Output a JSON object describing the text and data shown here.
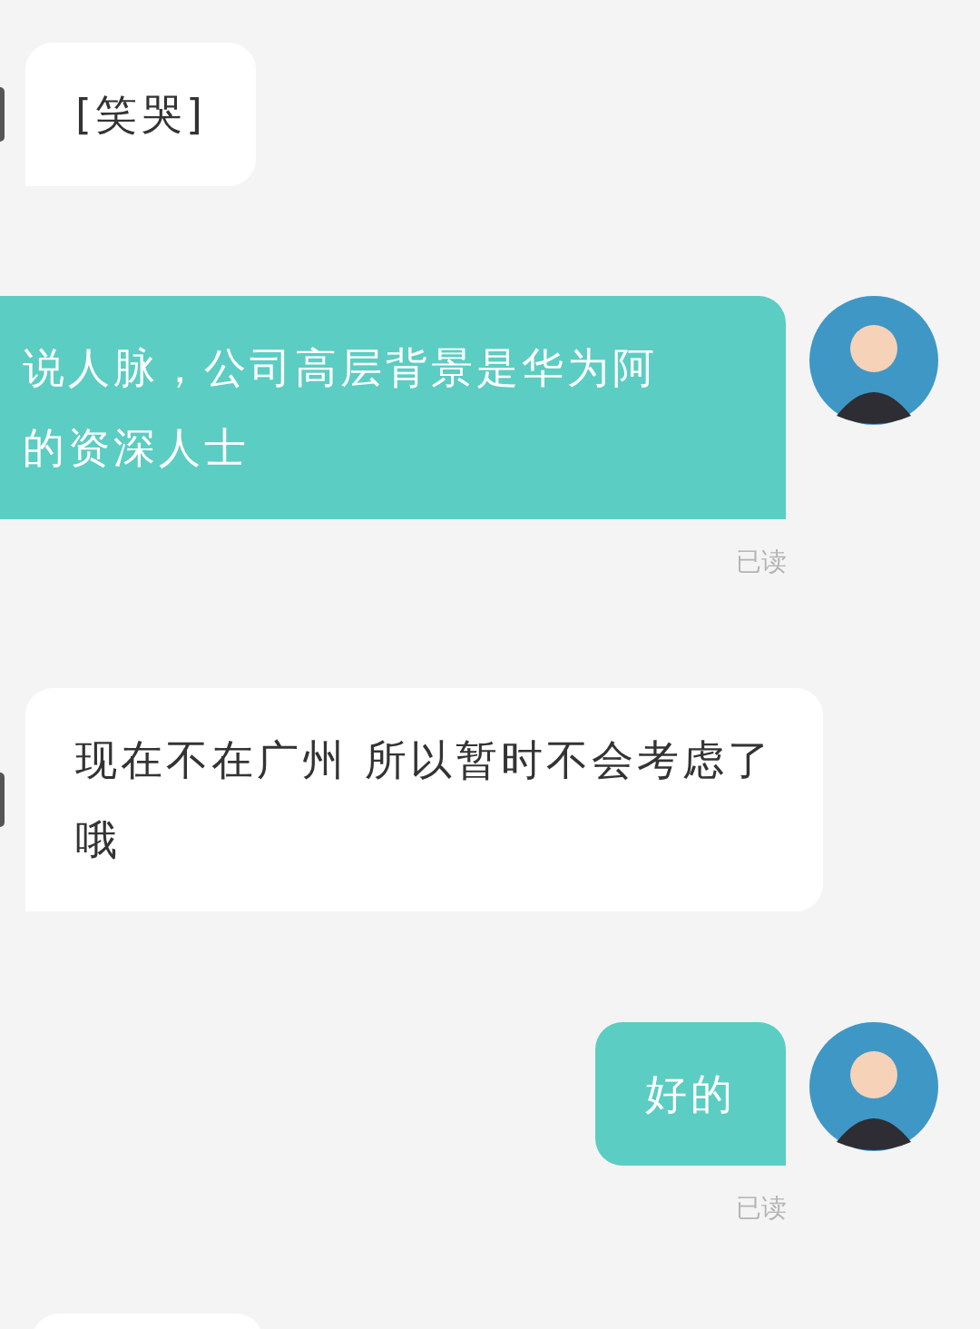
{
  "messages": [
    {
      "kind": "incoming",
      "lines": [
        "[笑哭]"
      ]
    },
    {
      "kind": "outgoing",
      "lines": [
        "说人脉，公司高层背景是华为阿",
        "的资深人士"
      ],
      "status": "已读"
    },
    {
      "kind": "incoming",
      "lines": [
        "现在不在广州 所以暂时不会考虑了",
        "哦"
      ]
    },
    {
      "kind": "outgoing",
      "lines": [
        "好的"
      ],
      "status": "已读"
    },
    {
      "kind": "incoming_partial"
    }
  ]
}
